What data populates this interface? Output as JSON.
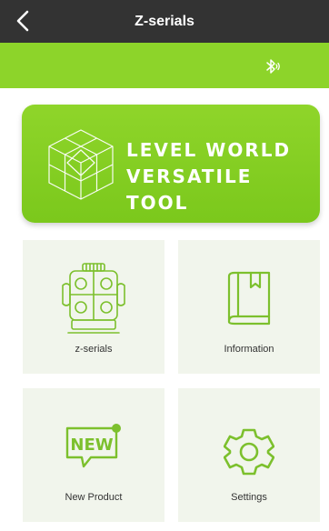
{
  "header": {
    "title": "Z-serials",
    "back_icon": "chevron-left-icon",
    "background": "#333333"
  },
  "toolbar": {
    "bluetooth_icon": "bluetooth-icon",
    "background": "#8dd42a"
  },
  "banner": {
    "line1": "LEVEL WORLD",
    "line2": "VERSATILE TOOL",
    "logo_icon": "level-cube-logo",
    "background": "#8dd42a"
  },
  "tiles": [
    {
      "label": "z-serials",
      "icon": "laser-level-device-icon"
    },
    {
      "label": "Information",
      "icon": "book-icon"
    },
    {
      "label": "New Product",
      "icon": "new-badge-icon",
      "icon_text": "NEW"
    },
    {
      "label": "Settings",
      "icon": "gear-icon"
    }
  ],
  "colors": {
    "accent": "#8dd42a",
    "icon_green": "#7cc02d",
    "tile_background": "#f1f5ec"
  }
}
